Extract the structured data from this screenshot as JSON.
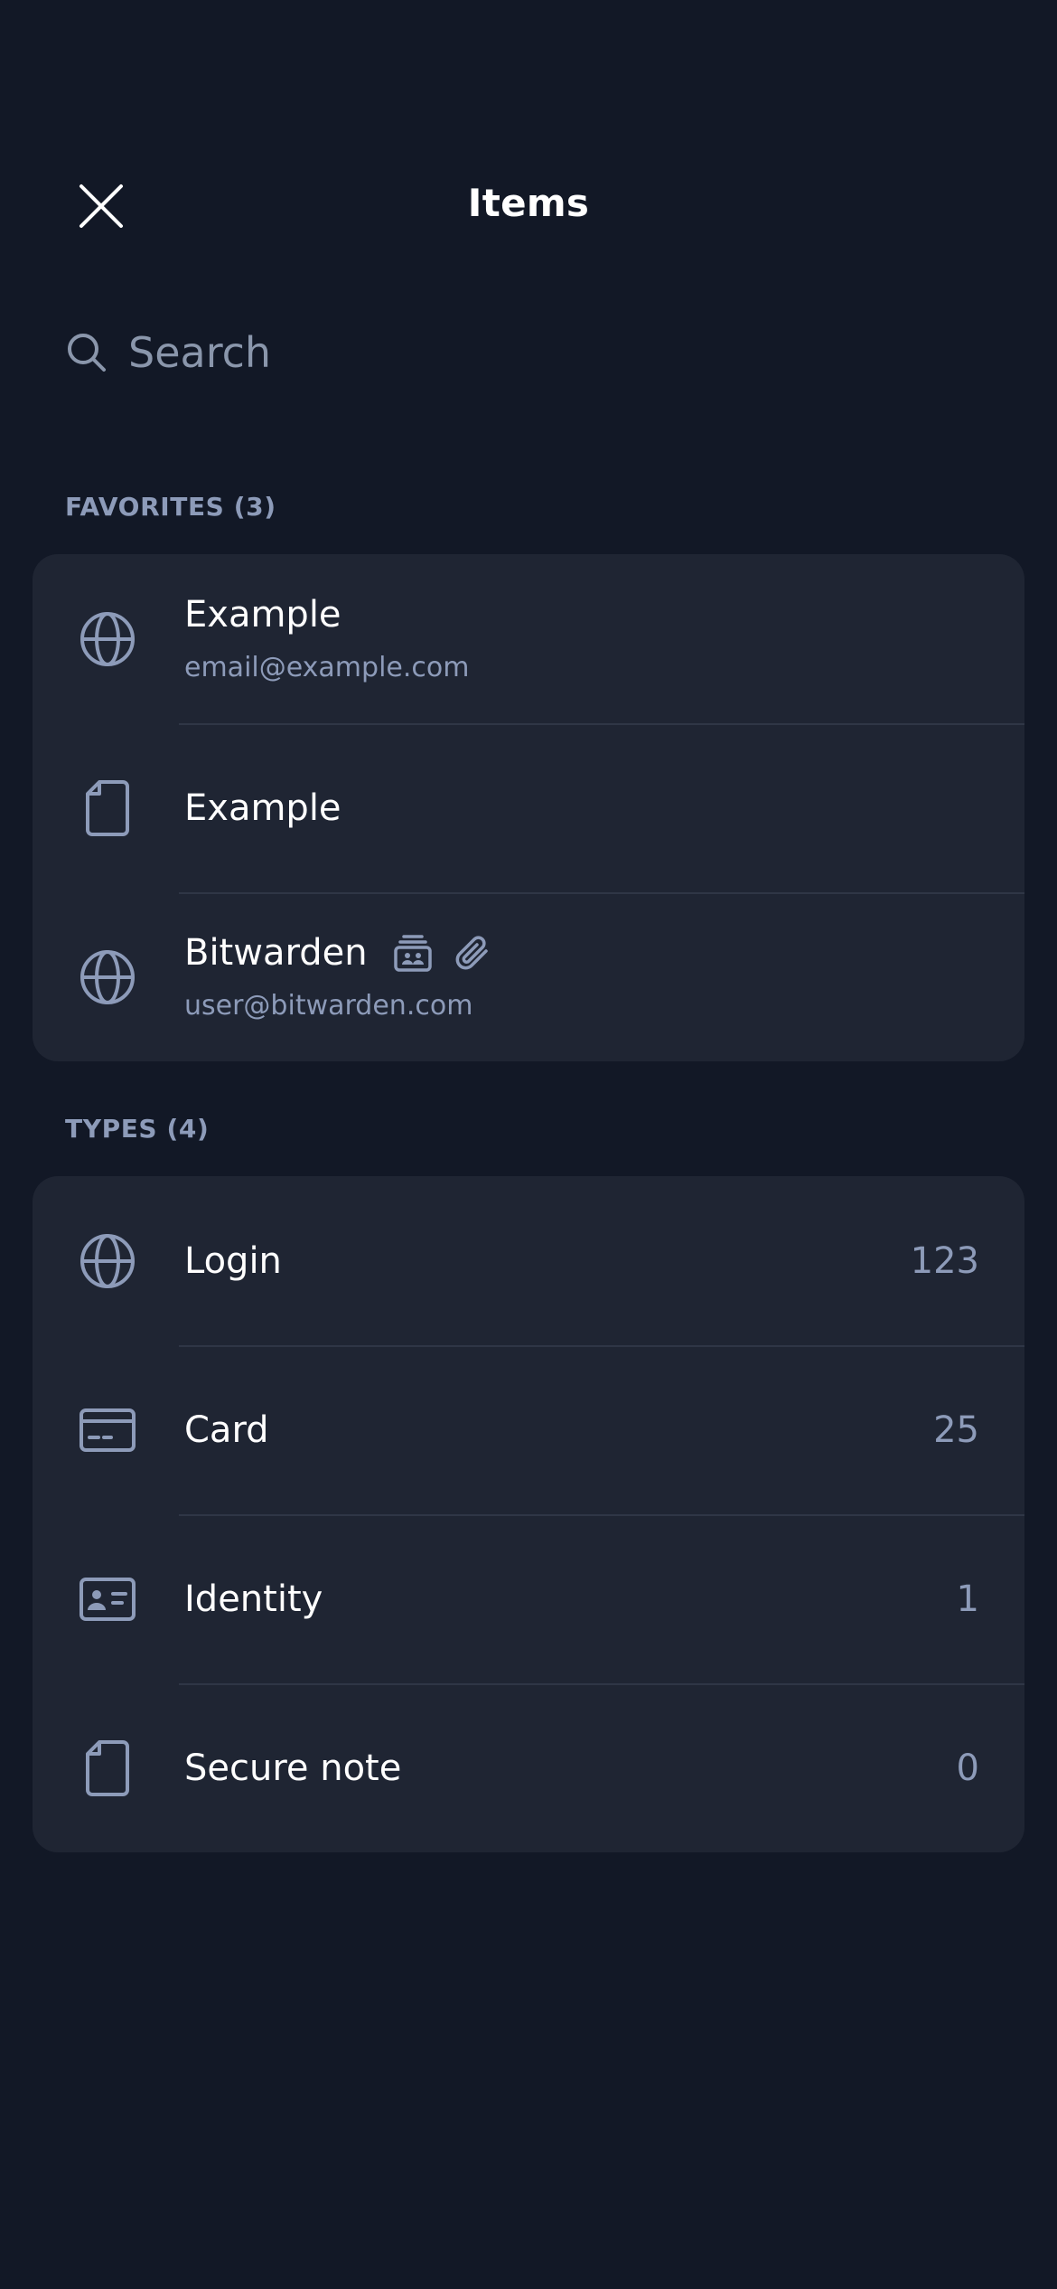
{
  "header": {
    "title": "Items",
    "close_icon": "close-icon"
  },
  "search": {
    "placeholder": "Search",
    "icon": "search-icon"
  },
  "favorites": {
    "label": "FAVORITES (3)",
    "items": [
      {
        "title": "Example",
        "subtitle": "email@example.com",
        "icon": "globe-icon"
      },
      {
        "title": "Example",
        "icon": "note-icon"
      },
      {
        "title": "Bitwarden",
        "subtitle": "user@bitwarden.com",
        "icon": "globe-icon",
        "badges": [
          "collection-icon",
          "attachment-icon"
        ]
      }
    ]
  },
  "types": {
    "label": "TYPES (4)",
    "items": [
      {
        "title": "Login",
        "count": "123",
        "icon": "globe-icon"
      },
      {
        "title": "Card",
        "count": "25",
        "icon": "card-icon"
      },
      {
        "title": "Identity",
        "count": "1",
        "icon": "identity-icon"
      },
      {
        "title": "Secure note",
        "count": "0",
        "icon": "note-icon"
      }
    ]
  },
  "colors": {
    "background": "#121826",
    "card": "#1f2533",
    "text": "#ffffff",
    "muted": "#8d9bb9",
    "divider": "#2f3646"
  }
}
